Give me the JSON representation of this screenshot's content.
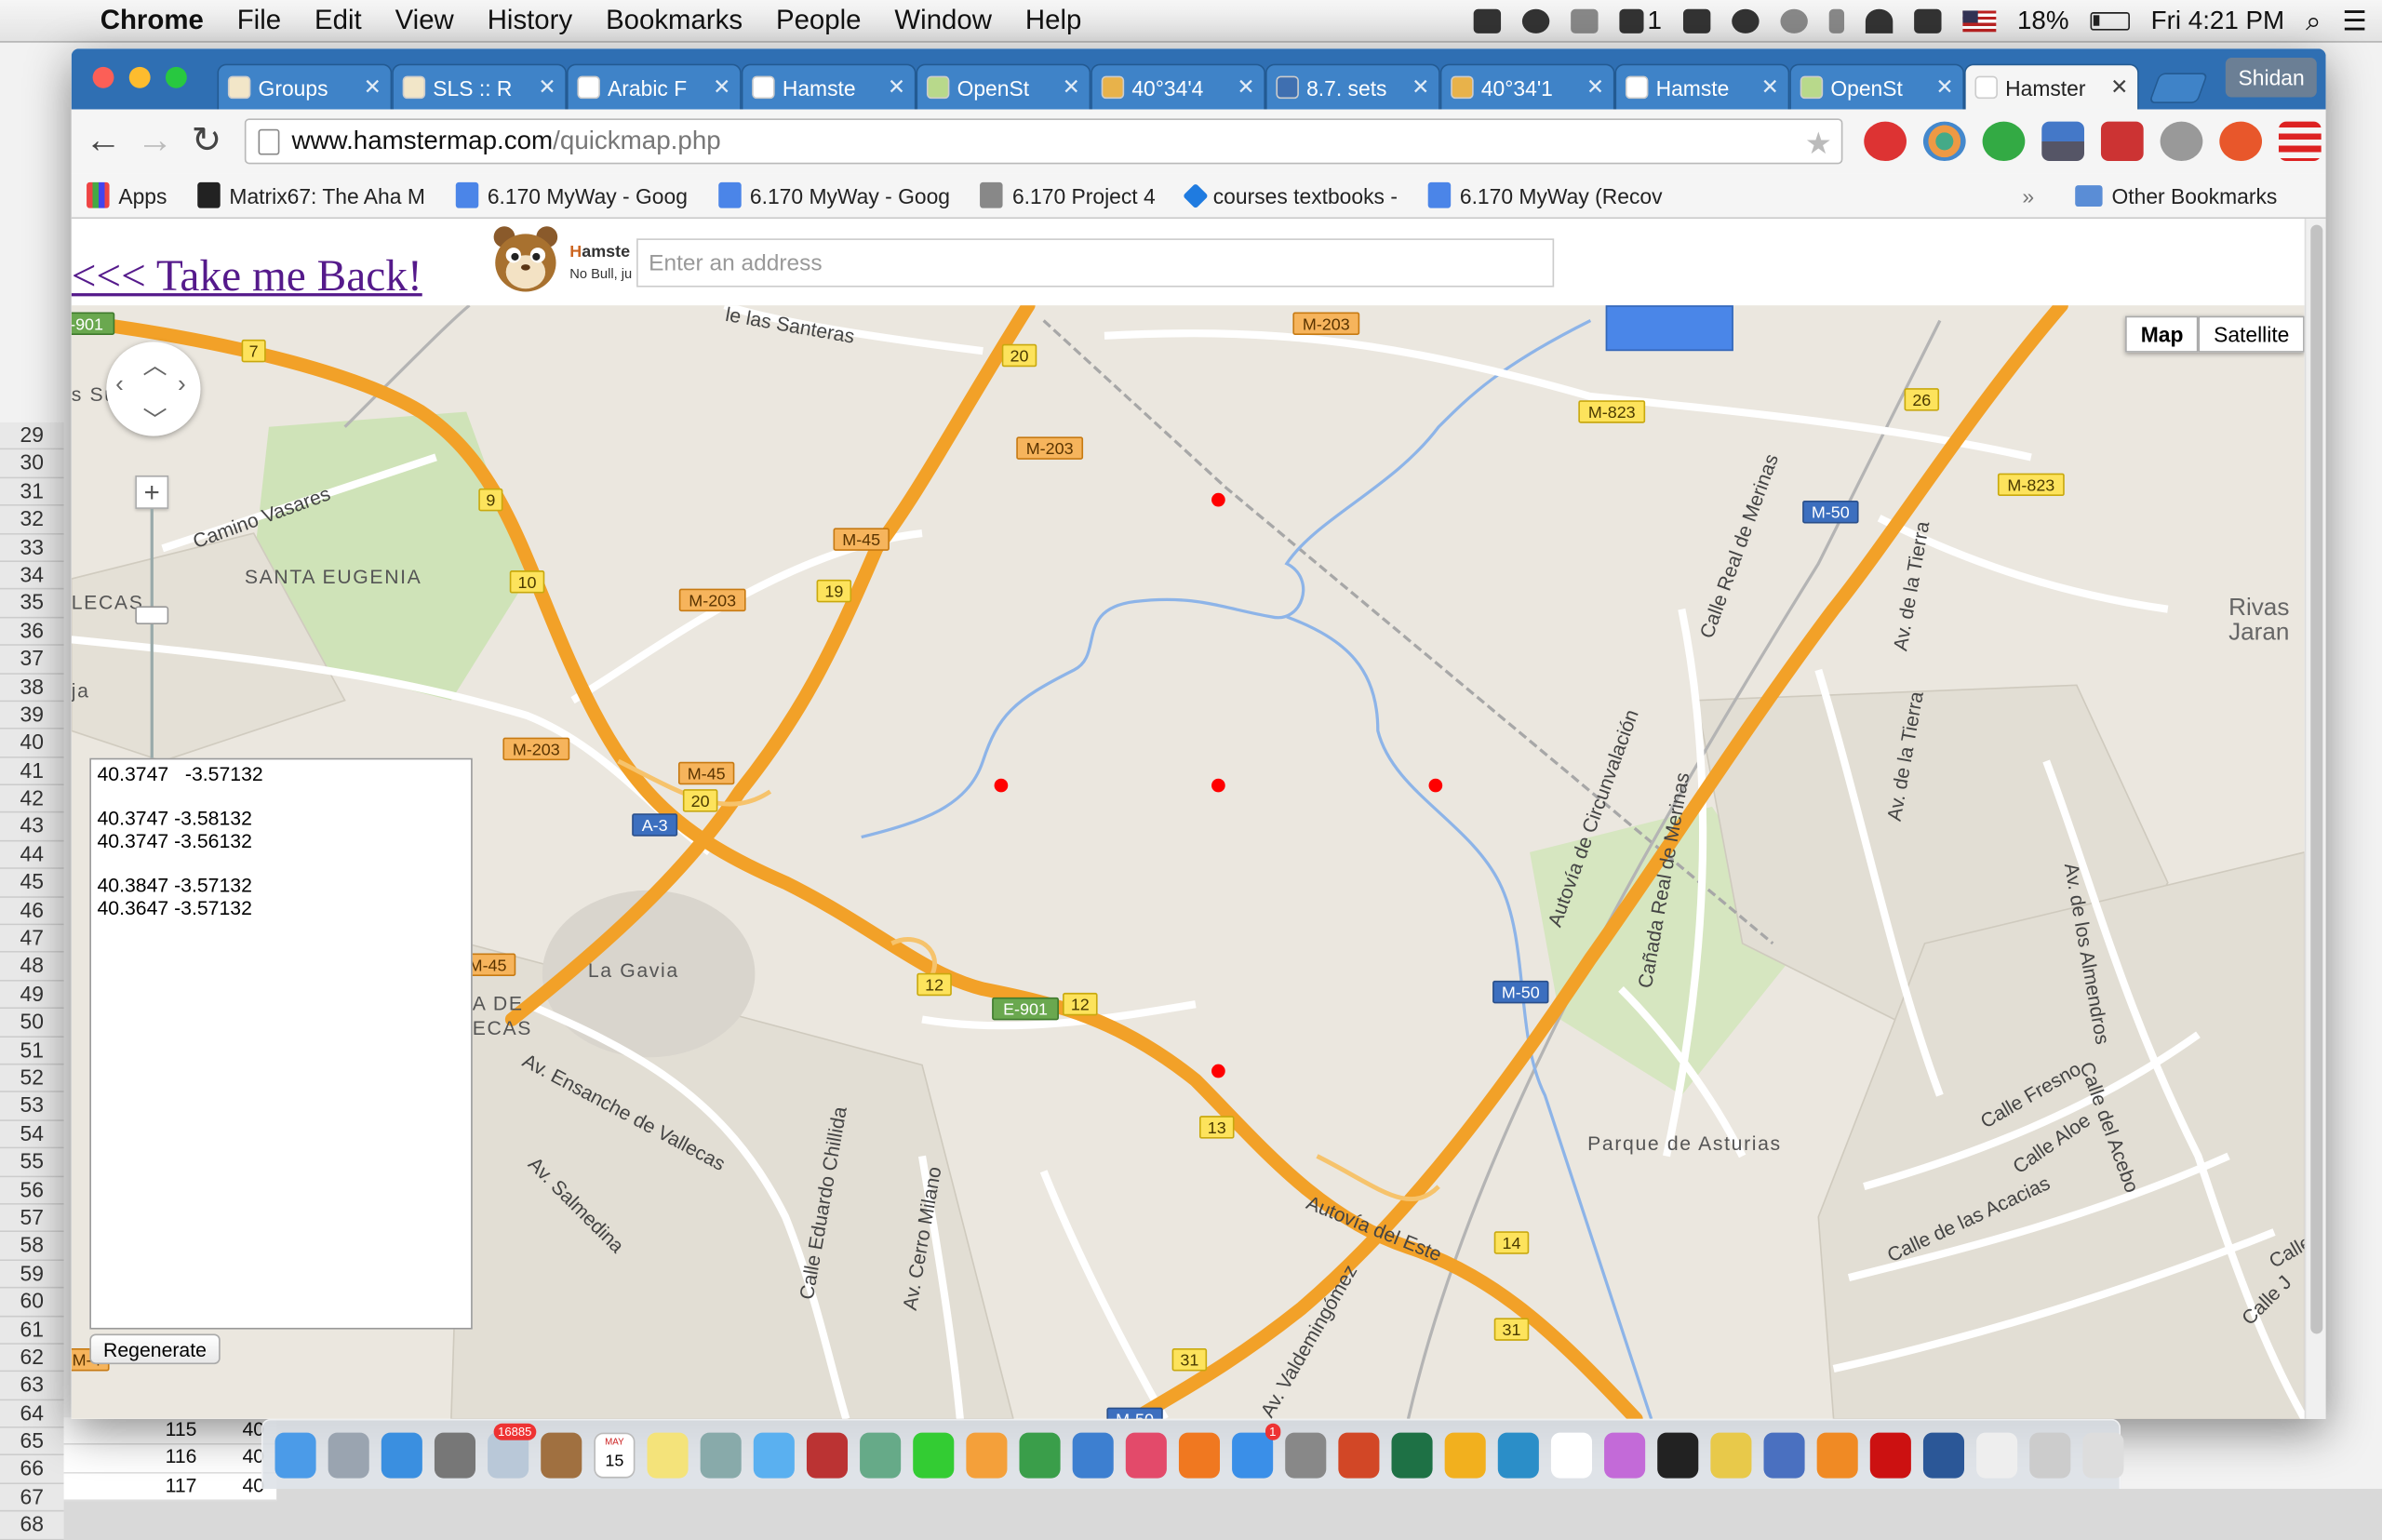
{
  "menubar": {
    "app_name": "Chrome",
    "items": [
      "File",
      "Edit",
      "View",
      "History",
      "Bookmarks",
      "People",
      "Window",
      "Help"
    ],
    "status": {
      "adobe_count": "1",
      "battery": "18%",
      "clock": "Fri 4:21 PM"
    }
  },
  "excel": {
    "row_numbers": [
      "29",
      "30",
      "31",
      "32",
      "33",
      "34",
      "35",
      "36",
      "37",
      "38",
      "39",
      "40",
      "41",
      "42",
      "43",
      "44",
      "45",
      "46",
      "47",
      "48",
      "49",
      "50",
      "51",
      "52",
      "53",
      "54",
      "55",
      "56",
      "57",
      "58",
      "59",
      "60",
      "61",
      "62",
      "63",
      "64",
      "65",
      "66",
      "67",
      "68"
    ],
    "cells": [
      [
        "115",
        "40"
      ],
      [
        "116",
        "40"
      ],
      [
        "117",
        "40"
      ]
    ]
  },
  "chrome": {
    "tabs": [
      {
        "title": "Groups",
        "favicon_color": "#f2e6c8"
      },
      {
        "title": "SLS :: R",
        "favicon_color": "#f2e6c8"
      },
      {
        "title": "Arabic F",
        "favicon_color": "#ffffff"
      },
      {
        "title": "Hamste",
        "favicon_color": "#ffffff"
      },
      {
        "title": "OpenSt",
        "favicon_color": "#b8d98b"
      },
      {
        "title": "40°34'4",
        "favicon_color": "#e8b24a"
      },
      {
        "title": "8.7. sets",
        "favicon_color": "#3f6fb0"
      },
      {
        "title": "40°34'1",
        "favicon_color": "#e8b24a"
      },
      {
        "title": "Hamste",
        "favicon_color": "#ffffff"
      },
      {
        "title": "OpenSt",
        "favicon_color": "#b8d98b"
      },
      {
        "title": "Hamster",
        "favicon_color": "#ffffff",
        "active": true
      }
    ],
    "profile_name": "Shidan",
    "url_host": "www.hamstermap.com",
    "url_path": "/quickmap.php",
    "bookmarks": [
      {
        "label": "Apps",
        "icon": "apps-grid-icon"
      },
      {
        "label": "Matrix67: The Aha M",
        "icon": "matrix67-icon"
      },
      {
        "label": "6.170 MyWay - Goog",
        "icon": "google-doc-icon"
      },
      {
        "label": "6.170 MyWay - Goog",
        "icon": "google-doc-icon"
      },
      {
        "label": "6.170 Project 4",
        "icon": "contact-icon"
      },
      {
        "label": "courses textbooks -",
        "icon": "dropbox-icon"
      },
      {
        "label": "6.170 MyWay (Recov",
        "icon": "google-doc-icon"
      }
    ],
    "overflow_chevron": "»",
    "other_bookmarks": "Other Bookmarks"
  },
  "page": {
    "back_link": "<<< Take me Back!",
    "logo_brand_initial": "H",
    "logo_brand_rest": "amste",
    "logo_tagline": "No Bull, ju",
    "address_placeholder": "Enter an address",
    "map_type": {
      "map": "Map",
      "satellite": "Satellite",
      "selected": "Map"
    },
    "coordinates_text": "40.3747   -3.57132\n\n40.3747 -3.58132\n40.3747 -3.56132\n\n40.3847 -3.57132\n40.3647 -3.57132",
    "regenerate_label": "Regenerate"
  },
  "map": {
    "marker_color": "#ff0000",
    "road_labels": [
      {
        "text": "M-203",
        "kind": "orange"
      },
      {
        "text": "M-203",
        "kind": "orange"
      },
      {
        "text": "M-203",
        "kind": "orange"
      },
      {
        "text": "M-203",
        "kind": "orange"
      },
      {
        "text": "M-823",
        "kind": "yellow"
      },
      {
        "text": "M-823",
        "kind": "yellow"
      },
      {
        "text": "M-45",
        "kind": "orange"
      },
      {
        "text": "M-45",
        "kind": "orange"
      },
      {
        "text": "M-45",
        "kind": "orange"
      },
      {
        "text": "M-50",
        "kind": "blue"
      },
      {
        "text": "M-50",
        "kind": "blue"
      },
      {
        "text": "M-50",
        "kind": "blue"
      },
      {
        "text": "A-3",
        "kind": "blue"
      },
      {
        "text": "E-901",
        "kind": "green"
      },
      {
        "text": "-901",
        "kind": "green"
      },
      {
        "text": "7",
        "kind": "yellow"
      },
      {
        "text": "9",
        "kind": "yellow"
      },
      {
        "text": "10",
        "kind": "yellow"
      },
      {
        "text": "19",
        "kind": "yellow"
      },
      {
        "text": "20",
        "kind": "yellow"
      },
      {
        "text": "20",
        "kind": "yellow"
      },
      {
        "text": "12",
        "kind": "yellow"
      },
      {
        "text": "12",
        "kind": "yellow"
      },
      {
        "text": "13",
        "kind": "yellow"
      },
      {
        "text": "14",
        "kind": "yellow"
      },
      {
        "text": "26",
        "kind": "yellow"
      },
      {
        "text": "31",
        "kind": "yellow"
      },
      {
        "text": "31",
        "kind": "yellow"
      },
      {
        "text": "M-4",
        "kind": "orange"
      }
    ],
    "place_labels": [
      "Camino Vasares",
      "SANTA EUGENIA",
      "LECAS",
      "s Su",
      "ja",
      "La Gavia",
      "A DE",
      "ECAS",
      "Av. Ensanche de Vallecas",
      "Av. Salmedina",
      "Calle Eduardo Chillida",
      "Av. Cerro Milano",
      "Autovía del Este",
      "Av. Valdemingómez",
      "Autovía de Circunvalación",
      "Cañada Real de Merinas",
      "Calle Real de Merinas",
      "Av. de la Tierra",
      "Av. de la Tierra",
      "Av. de los Almendros",
      "Parque de Asturias",
      "Calle Fresno",
      "Calle Aloe",
      "Calle del Acebo",
      "Calle de las Acacias",
      "Calle J",
      "Calle",
      "Rivas",
      "Jaran",
      "le las Santeras"
    ]
  },
  "dock": {
    "apps": [
      "finder-icon",
      "launchpad-icon",
      "safari-icon",
      "calculator-grid-icon",
      "photo-mail-icon",
      "contacts-icon",
      "calendar-icon",
      "notes-icon",
      "preview-icon",
      "messages-icon",
      "photo-booth-icon",
      "image-capture-icon",
      "facetime-icon",
      "pages-icon",
      "numbers-icon",
      "keynote-icon",
      "itunes-icon",
      "ibooks-icon",
      "app-store-icon",
      "system-preferences-icon",
      "powerpoint-icon",
      "excel-icon",
      "outlook-icon",
      "lync-icon",
      "textedit-icon",
      "daisy-icon",
      "terminal-icon",
      "chrome-icon",
      "migration-icon",
      "sublime-icon",
      "acrobat-icon",
      "word-icon",
      "document-icon",
      "screenshot-icon",
      "trash-icon"
    ],
    "mail_badge": "16885",
    "calendar_month": "MAY",
    "calendar_day": "15",
    "appstore_badge": "1"
  }
}
